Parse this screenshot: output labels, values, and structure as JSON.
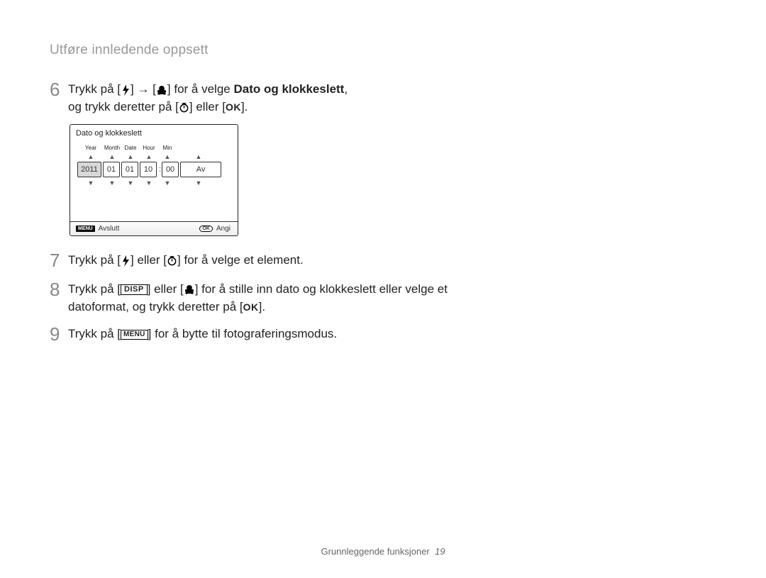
{
  "section_title": "Utføre innledende oppsett",
  "steps": {
    "s6": {
      "num": "6",
      "t1": "Trykk på [",
      "t2": "] → [",
      "t3": "] for å velge ",
      "bold": "Dato og klokkeslett",
      "t4": ",",
      "t5": "og trykk deretter på [",
      "t6": "] eller [",
      "t7": "]."
    },
    "s7": {
      "num": "7",
      "t1": "Trykk på [",
      "t2": "] eller [",
      "t3": "] for å velge et element."
    },
    "s8": {
      "num": "8",
      "t1": "Trykk på [",
      "disp": "DISP",
      "t2": "] eller [",
      "t3": "] for å stille inn dato og klokkeslett eller velge et datoformat, og trykk deretter på [",
      "t4": "]."
    },
    "s9": {
      "num": "9",
      "t1": "Trykk på [",
      "menu": "MENU",
      "t2": "] for å bytte til fotograferingsmodus."
    }
  },
  "ok_label": "OK",
  "lcd": {
    "title": "Dato og klokkeslett",
    "labels": {
      "year": "Year",
      "month": "Month",
      "date": "Date",
      "hour": "Hour",
      "min": "Min"
    },
    "values": {
      "year": "2011",
      "month": "01",
      "date": "01",
      "hour": "10",
      "min": "00",
      "mode": "Av"
    },
    "arrow_up": "▲",
    "arrow_down": "▼",
    "footer": {
      "menu": "MENU",
      "exit": "Avslutt",
      "ok": "OK",
      "set": "Angi"
    }
  },
  "footer": {
    "text": "Grunnleggende funksjoner",
    "page": "19"
  }
}
